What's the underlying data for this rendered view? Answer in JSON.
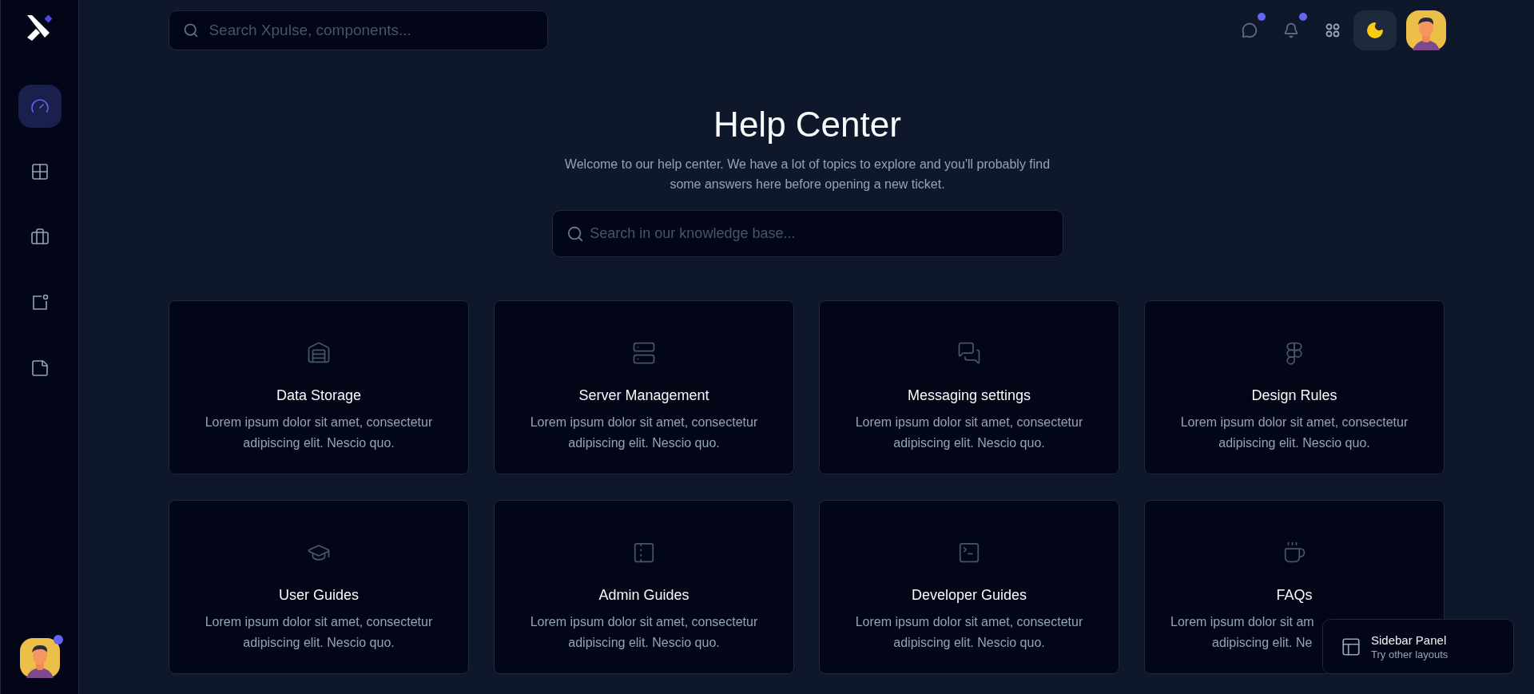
{
  "topbar": {
    "search": {
      "placeholder": "Search Xpulse, components..."
    },
    "actions": [
      {
        "notify": true
      },
      {
        "notify": true
      },
      {
        "notify": false
      }
    ]
  },
  "sidebar": {
    "items": [
      {
        "selected": true
      },
      {
        "selected": false
      },
      {
        "selected": false
      },
      {
        "selected": false
      },
      {
        "selected": false
      }
    ],
    "user": {
      "online": true
    }
  },
  "hero": {
    "title": "Help Center",
    "subtitle": "Welcome to our help center. We have a lot of topics to explore and you'll probably find some answers here before opening a new ticket.",
    "search": {
      "placeholder": "Search in our knowledge base..."
    }
  },
  "cards": [
    {
      "kind": "full",
      "title": "Data Storage",
      "lines": [
        "Lorem ipsum dolor sit amet, consectetur",
        "adipiscing elit. Nescio quo."
      ]
    },
    {
      "kind": "full",
      "title": "Server Management",
      "lines": [
        "Lorem ipsum dolor sit amet, consectetur",
        "adipiscing elit. Nescio quo."
      ]
    },
    {
      "kind": "full",
      "title": "Messaging settings",
      "lines": [
        "Lorem ipsum dolor sit amet, consectetur",
        "adipiscing elit. Nescio quo."
      ]
    },
    {
      "kind": "full",
      "title": "Design Rules",
      "lines": [
        "Lorem ipsum dolor sit amet, consectetur",
        "adipiscing elit. Nescio quo."
      ]
    },
    {
      "kind": "full",
      "title": "User Guides",
      "lines": [
        "Lorem ipsum dolor sit amet, consectetur",
        "adipiscing elit. Nescio quo."
      ]
    },
    {
      "kind": "full",
      "title": "Admin Guides",
      "lines": [
        "Lorem ipsum dolor sit amet, consectetur",
        "adipiscing elit. Nescio quo."
      ]
    },
    {
      "kind": "full",
      "title": "Developer Guides",
      "lines": [
        "Lorem ipsum dolor sit amet, consectetur",
        "adipiscing elit. Nescio quo."
      ]
    },
    {
      "kind": "covered",
      "title": "FAQs",
      "lines": [
        "Lorem ipsum dolor sit am",
        "adipiscing elit. Ne"
      ]
    }
  ],
  "layout_panel": {
    "title": "Sidebar Panel",
    "subtitle": "Try other layouts"
  }
}
